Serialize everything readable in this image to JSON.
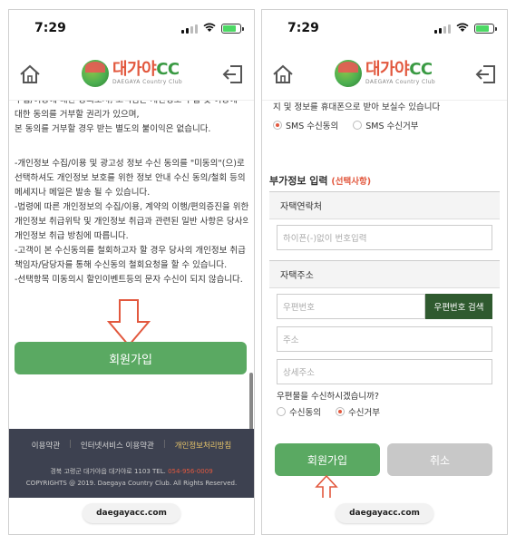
{
  "status_bar": {
    "time": "7:29"
  },
  "header": {
    "logo_title_a": "대가야",
    "logo_title_b": "CC",
    "logo_subtitle": "DAEGAYA Country Club"
  },
  "left": {
    "lines": [
      "수집/이용에 대한 동의로서, 고객님은 개인정보 수집 및 이용에",
      "대한 동의를 거부할 권리가 있으며,",
      "본 동의를 거부할 경우 받는 별도의 불이익은 없습니다.",
      "",
      "-개인정보 수집/이용 및 광고성 정보 수신 동의를 \"미동의\"(으)로",
      "선택하셔도 개인정보 보호를 위한 정보 안내 수신 동의/철회 등의",
      "메세지나 메일은 발송 될 수 있습니다.",
      "-법령에 따른 개인정보의 수집/이용, 계약의 이행/편의증진을 위한",
      "개인정보 취급위탁 및 개인정보 취급과 관련된 일반 사항은 당사의",
      "개인정보 취급 방침에 따릅니다.",
      "-고객이 본 수신동의를 철회하고자 할 경우 당사의 개인정보 취급",
      "책임자/담당자를 통해 수신동의 철회요청을 할 수 있습니다.",
      "-선택항목 미동의시 할인이벤트등의 문자 수신이 되지 않습니다."
    ],
    "join_button": "회원가입",
    "footer": {
      "link1": "이용약관",
      "link2": "인터넷서비스 이용약관",
      "link3": "개인정보처리방침",
      "sep": "|",
      "address": "경북 고령군 대가야읍 대가야로 1103 TEL.",
      "tel": "054-956-0009",
      "copyright": "COPYRIGHTS @ 2019. Daegaya Country Club. All Rights Reserved."
    }
  },
  "right": {
    "sms_notice": "지 및 정보를 휴대폰으로 받아 보실수 있습니다",
    "sms_agree": "SMS 수신동의",
    "sms_reject": "SMS 수신거부",
    "section_title": "부가정보 입력",
    "section_optional": "(선택사항)",
    "contact_label": "자택연락처",
    "phone_placeholder": "하이픈(-)없이 번호입력",
    "address_label": "자택주소",
    "zip_placeholder": "우편번호",
    "zip_button": "우편번호 검색",
    "addr_placeholder": "주소",
    "addr_detail_placeholder": "상세주소",
    "mail_question": "우편물을 수신하시겠습니까?",
    "mail_agree": "수신동의",
    "mail_reject": "수신거부",
    "join_button": "회원가입",
    "cancel_button": "취소"
  },
  "urlbar": {
    "domain": "daegayacc.com"
  }
}
